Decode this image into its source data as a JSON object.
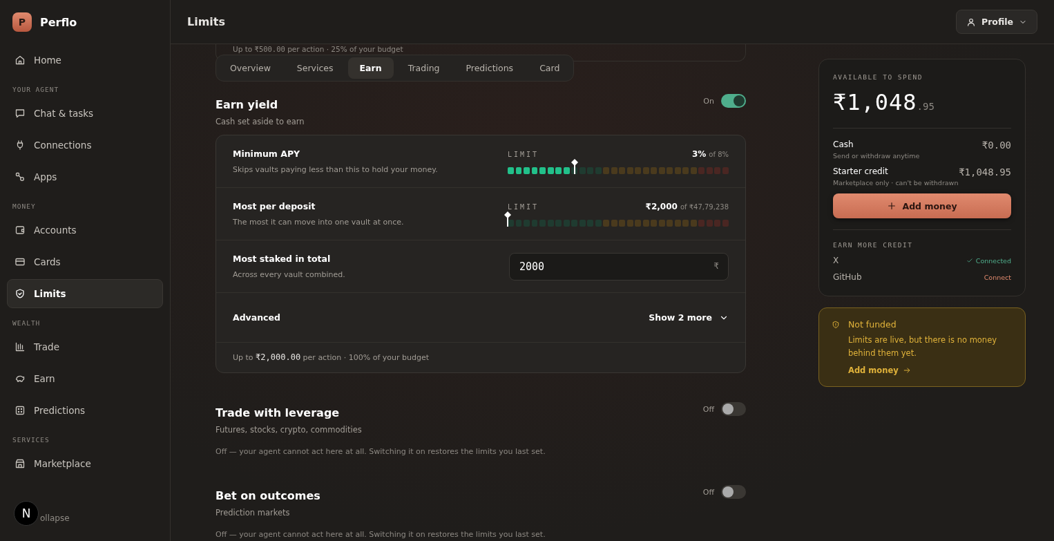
{
  "brand": {
    "letter": "P",
    "name": "Perflo"
  },
  "sidebar": {
    "items": [
      {
        "kind": "link",
        "label": "Home",
        "selected": false
      },
      {
        "kind": "section",
        "label": "YOUR AGENT"
      },
      {
        "kind": "link",
        "label": "Chat & tasks",
        "selected": false
      },
      {
        "kind": "link",
        "label": "Connections",
        "selected": false
      },
      {
        "kind": "link",
        "label": "Apps",
        "selected": false
      },
      {
        "kind": "section",
        "label": "MONEY"
      },
      {
        "kind": "link",
        "label": "Accounts",
        "selected": false
      },
      {
        "kind": "link",
        "label": "Cards",
        "selected": false
      },
      {
        "kind": "link",
        "label": "Limits",
        "selected": true
      },
      {
        "kind": "section",
        "label": "WEALTH"
      },
      {
        "kind": "link",
        "label": "Trade",
        "selected": false
      },
      {
        "kind": "link",
        "label": "Earn",
        "selected": false
      },
      {
        "kind": "link",
        "label": "Predictions",
        "selected": false
      },
      {
        "kind": "section",
        "label": "SERVICES"
      },
      {
        "kind": "link",
        "label": "Marketplace",
        "selected": false
      }
    ],
    "collapse": "ollapse",
    "dev_badge": "N"
  },
  "header": {
    "title": "Limits",
    "profile": "Profile"
  },
  "previous_card_footer": {
    "prefix": "Up to",
    "amount": "₹500.00",
    "suffix": "per action · 25% of your budget"
  },
  "tabs": [
    {
      "label": "Overview",
      "selected": false
    },
    {
      "label": "Services",
      "selected": false
    },
    {
      "label": "Earn",
      "selected": true
    },
    {
      "label": "Trading",
      "selected": false
    },
    {
      "label": "Predictions",
      "selected": false
    },
    {
      "label": "Card",
      "selected": false
    }
  ],
  "sections": [
    {
      "title": "Earn yield",
      "subtitle": "Cash set aside to earn",
      "toggle_label": "On",
      "on": true,
      "rows": [
        {
          "kind": "meter",
          "title": "Minimum APY",
          "description": "Skips vaults paying less than this to hold your money.",
          "meter_label": "LIMIT",
          "value": "3%",
          "of": "of 8%",
          "level": 0.3
        },
        {
          "kind": "meter",
          "title": "Most per deposit",
          "description": "The most it can move into one vault at once.",
          "meter_label": "LIMIT",
          "value": "₹2,000",
          "of": "of ₹47,79,238",
          "level": 0
        },
        {
          "kind": "input",
          "title": "Most staked in total",
          "description": "Across every vault combined.",
          "value": "2000",
          "unit": "₹"
        },
        {
          "kind": "expander",
          "title": "Advanced",
          "action": "Show 2 more"
        }
      ],
      "footer": {
        "prefix": "Up to",
        "amount": "₹2,000.00",
        "suffix": "per action · 100% of your budget"
      }
    },
    {
      "title": "Trade with leverage",
      "subtitle": "Futures, stocks, crypto, commodities",
      "toggle_label": "Off",
      "on": false,
      "note": "Off — your agent cannot act here at all. Switching it on restores the limits you last set."
    },
    {
      "title": "Bet on outcomes",
      "subtitle": "Prediction markets",
      "toggle_label": "Off",
      "on": false,
      "note": "Off — your agent cannot act here at all. Switching it on restores the limits you last set."
    }
  ],
  "balance": {
    "label": "AVAILABLE TO SPEND",
    "amount": "₹1,048",
    "cents": ".95",
    "lines": [
      {
        "title": "Cash",
        "subtitle": "Send or withdraw anytime",
        "value": "₹0.00"
      },
      {
        "title": "Starter credit",
        "subtitle": "Marketplace only · can't be withdrawn",
        "value": "₹1,048.95"
      }
    ],
    "button": "Add money",
    "earn_label": "EARN MORE CREDIT",
    "credits": [
      {
        "name": "X",
        "status": "Connected",
        "connected": true
      },
      {
        "name": "GitHub",
        "status": "Connect",
        "connected": false
      }
    ]
  },
  "alert": {
    "title": "Not funded",
    "text": "Limits are live, but there is no money behind them yet.",
    "link": "Add money"
  }
}
